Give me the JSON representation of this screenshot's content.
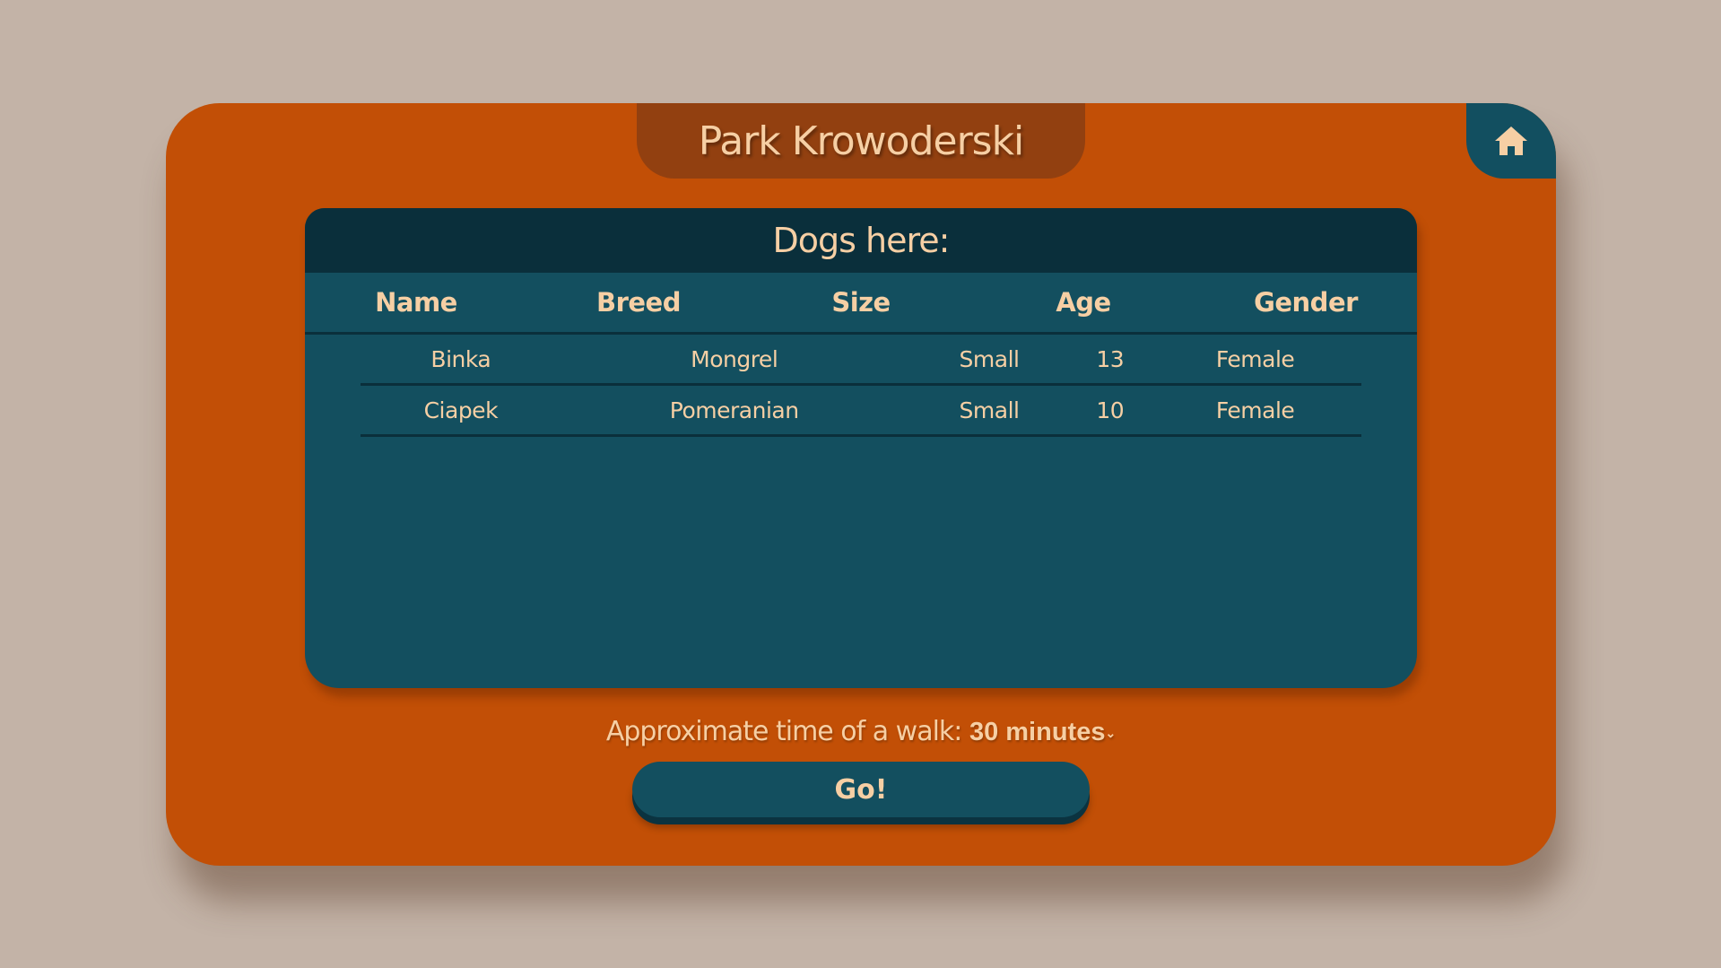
{
  "park": {
    "title": "Park Krowoderski"
  },
  "nav": {
    "home_icon": "home-icon"
  },
  "dogs_panel": {
    "heading": "Dogs here:",
    "columns": [
      "Name",
      "Breed",
      "Size",
      "Age",
      "Gender"
    ],
    "rows": [
      [
        "Binka",
        "Mongrel",
        "Small",
        "13",
        "Female"
      ],
      [
        "Ciapek",
        "Pomeranian",
        "Small",
        "10",
        "Female"
      ]
    ]
  },
  "walk": {
    "label": "Approximate time of a walk:",
    "selected": "30 minutes",
    "chevron_icon": "chevron-down-icon"
  },
  "actions": {
    "go_label": "Go!"
  },
  "colors": {
    "background": "#c3b3a7",
    "card": "#c24f06",
    "title_tab": "#924010",
    "panel": "#134f5f",
    "panel_header": "#0a2f3b",
    "text": "#f6cfa4"
  }
}
